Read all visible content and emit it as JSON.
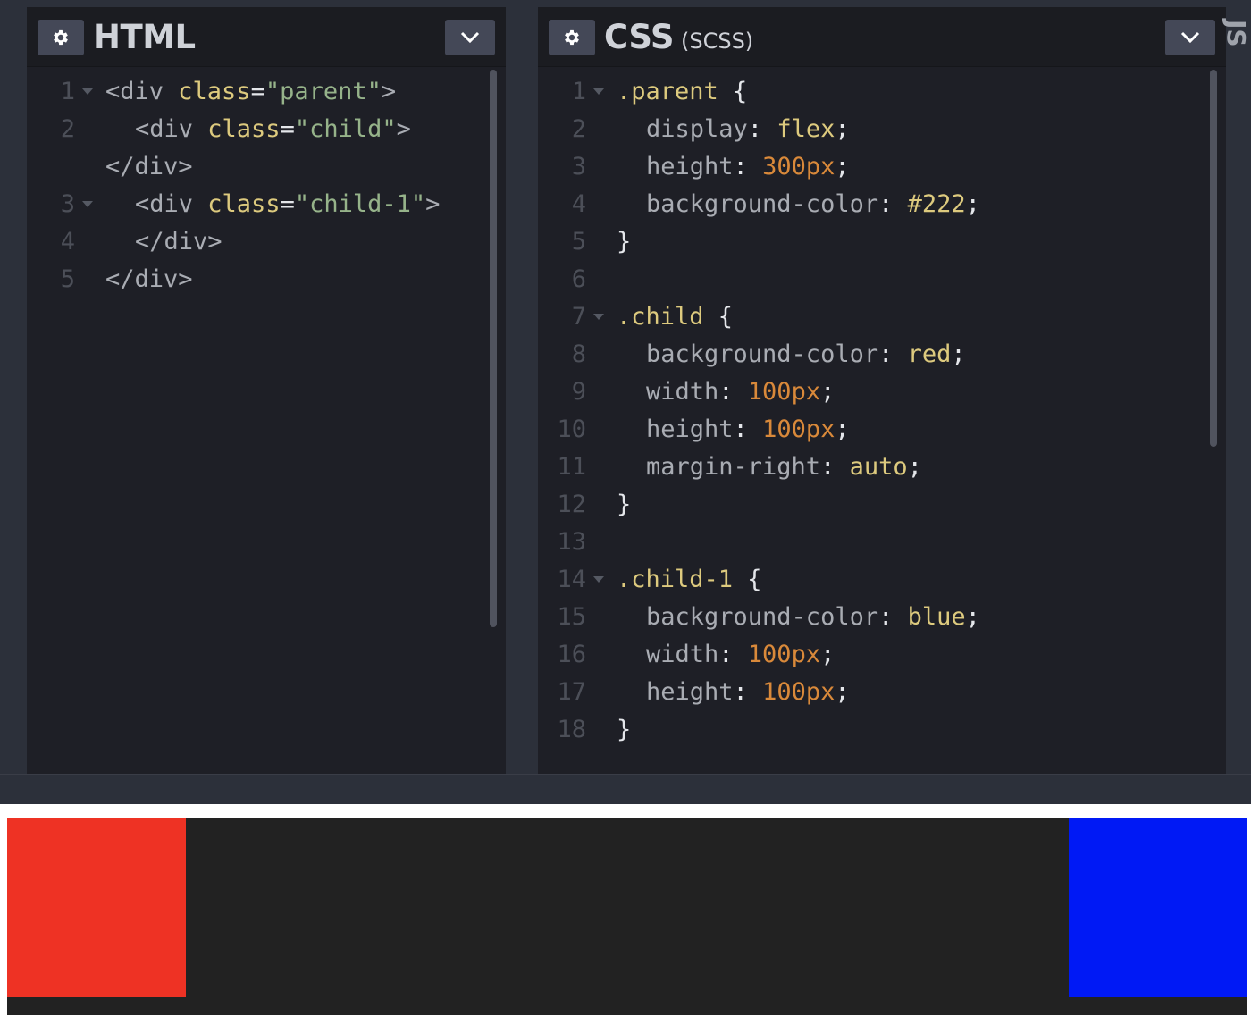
{
  "html_panel": {
    "title": "HTML",
    "lines": [
      {
        "num": "1",
        "fold": true,
        "indent": 0,
        "parts": [
          [
            "tag",
            "<div "
          ],
          [
            "attr",
            "class"
          ],
          [
            "pun",
            "="
          ],
          [
            "str",
            "\"parent\""
          ],
          [
            "tag",
            ">"
          ]
        ]
      },
      {
        "num": "2",
        "fold": false,
        "indent": 1,
        "parts": [
          [
            "tag",
            "<div "
          ],
          [
            "attr",
            "class"
          ],
          [
            "pun",
            "="
          ],
          [
            "str",
            "\"child\""
          ],
          [
            "tag",
            ">"
          ]
        ]
      },
      {
        "num": "",
        "fold": false,
        "indent": 0,
        "parts": [
          [
            "tag",
            "</div>"
          ]
        ]
      },
      {
        "num": "3",
        "fold": true,
        "indent": 1,
        "parts": [
          [
            "tag",
            "<div "
          ],
          [
            "attr",
            "class"
          ],
          [
            "pun",
            "="
          ],
          [
            "str",
            "\"child-1\""
          ],
          [
            "tag",
            ">"
          ]
        ]
      },
      {
        "num": "4",
        "fold": false,
        "indent": 1,
        "parts": [
          [
            "tag",
            "</div>"
          ]
        ]
      },
      {
        "num": "5",
        "fold": false,
        "indent": 0,
        "parts": [
          [
            "tag",
            "</div>"
          ]
        ]
      }
    ]
  },
  "css_panel": {
    "title": "CSS",
    "subtitle": "(SCSS)",
    "lines": [
      {
        "num": "1",
        "fold": true,
        "indent": 0,
        "parts": [
          [
            "sel",
            ".parent"
          ],
          [
            "pun",
            " {"
          ]
        ]
      },
      {
        "num": "2",
        "fold": false,
        "indent": 1,
        "parts": [
          [
            "prop",
            "display"
          ],
          [
            "pun",
            ": "
          ],
          [
            "val",
            "flex"
          ],
          [
            "pun",
            ";"
          ]
        ]
      },
      {
        "num": "3",
        "fold": false,
        "indent": 1,
        "parts": [
          [
            "prop",
            "height"
          ],
          [
            "pun",
            ": "
          ],
          [
            "num",
            "300px"
          ],
          [
            "pun",
            ";"
          ]
        ]
      },
      {
        "num": "4",
        "fold": false,
        "indent": 1,
        "parts": [
          [
            "prop",
            "background-color"
          ],
          [
            "pun",
            ": "
          ],
          [
            "val",
            "#222"
          ],
          [
            "pun",
            ";"
          ]
        ]
      },
      {
        "num": "5",
        "fold": false,
        "indent": 0,
        "parts": [
          [
            "pun",
            "}"
          ]
        ]
      },
      {
        "num": "6",
        "fold": false,
        "indent": 0,
        "parts": []
      },
      {
        "num": "7",
        "fold": true,
        "indent": 0,
        "parts": [
          [
            "sel",
            ".child"
          ],
          [
            "pun",
            " {"
          ]
        ]
      },
      {
        "num": "8",
        "fold": false,
        "indent": 1,
        "parts": [
          [
            "prop",
            "background-color"
          ],
          [
            "pun",
            ": "
          ],
          [
            "val",
            "red"
          ],
          [
            "pun",
            ";"
          ]
        ]
      },
      {
        "num": "9",
        "fold": false,
        "indent": 1,
        "parts": [
          [
            "prop",
            "width"
          ],
          [
            "pun",
            ": "
          ],
          [
            "num",
            "100px"
          ],
          [
            "pun",
            ";"
          ]
        ]
      },
      {
        "num": "10",
        "fold": false,
        "indent": 1,
        "parts": [
          [
            "prop",
            "height"
          ],
          [
            "pun",
            ": "
          ],
          [
            "num",
            "100px"
          ],
          [
            "pun",
            ";"
          ]
        ]
      },
      {
        "num": "11",
        "fold": false,
        "indent": 1,
        "parts": [
          [
            "prop",
            "margin-right"
          ],
          [
            "pun",
            ": "
          ],
          [
            "val",
            "auto"
          ],
          [
            "pun",
            ";"
          ]
        ]
      },
      {
        "num": "12",
        "fold": false,
        "indent": 0,
        "parts": [
          [
            "pun",
            "}"
          ]
        ]
      },
      {
        "num": "13",
        "fold": false,
        "indent": 0,
        "parts": []
      },
      {
        "num": "14",
        "fold": true,
        "indent": 0,
        "parts": [
          [
            "sel",
            ".child-1"
          ],
          [
            "pun",
            " {"
          ]
        ]
      },
      {
        "num": "15",
        "fold": false,
        "indent": 1,
        "parts": [
          [
            "prop",
            "background-color"
          ],
          [
            "pun",
            ": "
          ],
          [
            "val",
            "blue"
          ],
          [
            "pun",
            ";"
          ]
        ]
      },
      {
        "num": "16",
        "fold": false,
        "indent": 1,
        "parts": [
          [
            "prop",
            "width"
          ],
          [
            "pun",
            ": "
          ],
          [
            "num",
            "100px"
          ],
          [
            "pun",
            ";"
          ]
        ]
      },
      {
        "num": "17",
        "fold": false,
        "indent": 1,
        "parts": [
          [
            "prop",
            "height"
          ],
          [
            "pun",
            ": "
          ],
          [
            "num",
            "100px"
          ],
          [
            "pun",
            ";"
          ]
        ]
      },
      {
        "num": "18",
        "fold": false,
        "indent": 0,
        "parts": [
          [
            "pun",
            "}"
          ]
        ]
      }
    ]
  },
  "js_panel": {
    "title": "JS"
  },
  "icons": {
    "settings": "gear-icon",
    "collapse": "chevron-down-icon",
    "fold": "fold-triangle-icon"
  },
  "preview": {
    "parent_color": "#222222",
    "child_color": "#ee3224",
    "child1_color": "#0019f5"
  }
}
